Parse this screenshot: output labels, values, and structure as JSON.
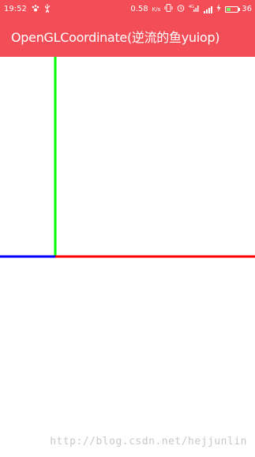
{
  "status_bar": {
    "time": "19:52",
    "net_speed": "0.58",
    "net_speed_unit": "K/s",
    "network_type": "4G",
    "battery_level": "36",
    "battery_fraction": 0.36,
    "left_icons": [
      "baidu-paw-icon",
      "usb-icon"
    ],
    "right_icons": [
      "vibrate-icon",
      "alarm-icon",
      "signal-4g-icon",
      "signal-bars-icon",
      "charging-bolt-icon",
      "battery-icon"
    ],
    "color": "#f34e57"
  },
  "app_bar": {
    "title": "OpenGLCoordinate(逆流的鱼yuiop)",
    "color": "#f34e57"
  },
  "canvas": {
    "axes": [
      {
        "name": "x-axis",
        "color": "#ff0000"
      },
      {
        "name": "y-axis",
        "color": "#00ff00"
      },
      {
        "name": "negative-x-axis",
        "color": "#0000ff"
      }
    ]
  },
  "watermark": {
    "text": "http://blog.csdn.net/hejjunlin"
  }
}
